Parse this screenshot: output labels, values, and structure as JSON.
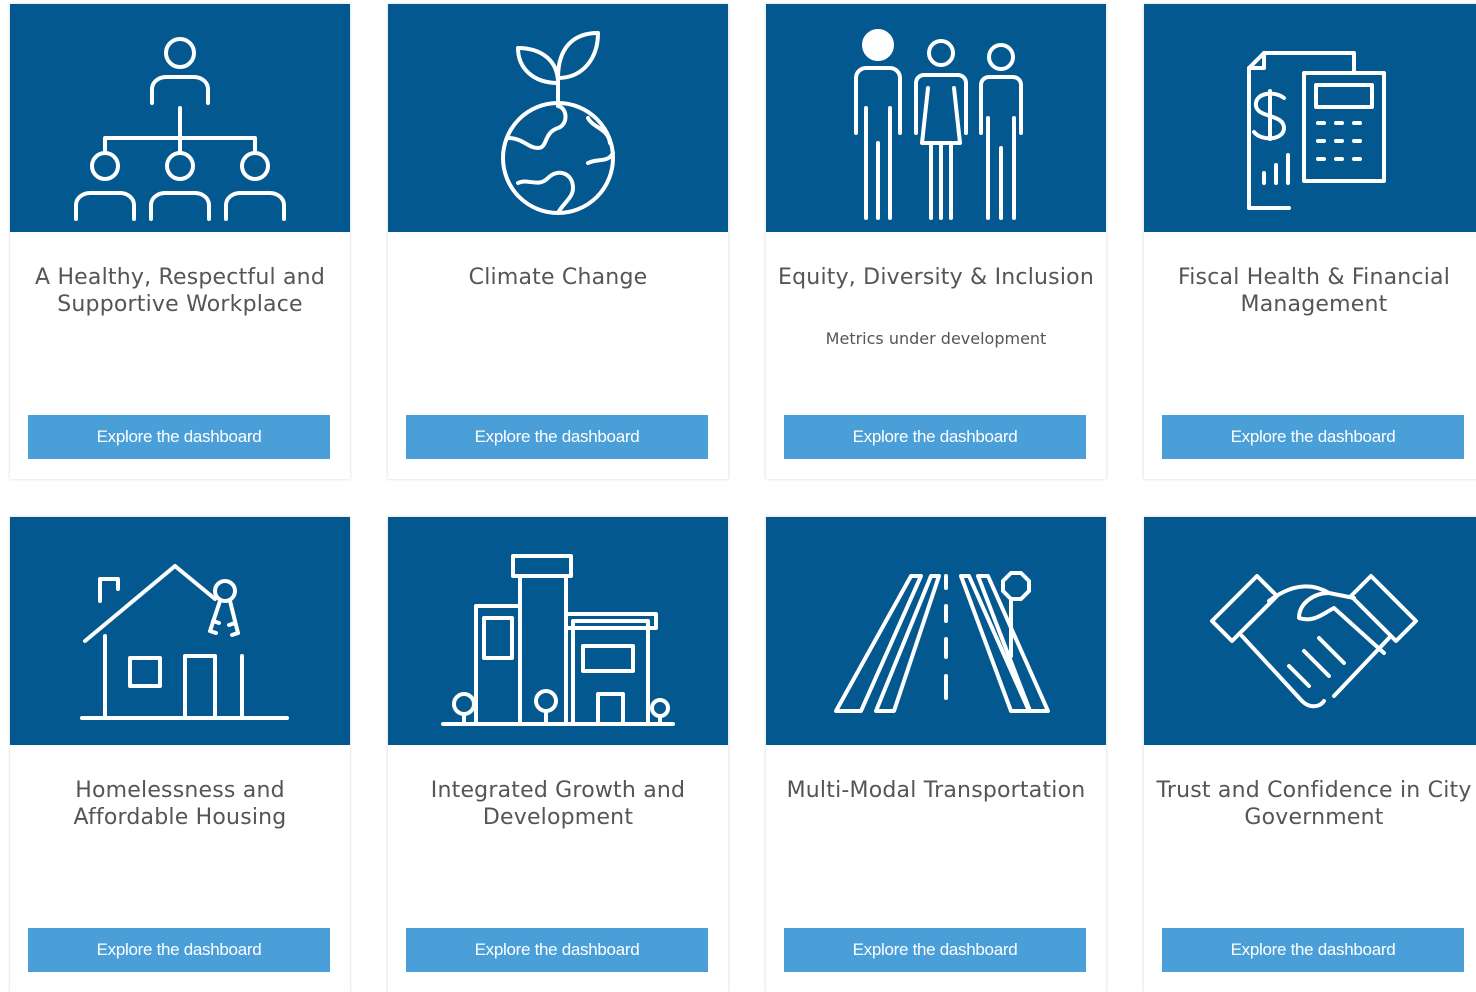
{
  "cards": [
    {
      "title": "A Healthy, Respectful and Supportive Workplace",
      "subtitle": "",
      "button": "Explore the dashboard",
      "icon": "org-chart-icon"
    },
    {
      "title": "Climate Change",
      "subtitle": "",
      "button": "Explore the dashboard",
      "icon": "plant-globe-icon"
    },
    {
      "title": "Equity, Diversity & Inclusion",
      "subtitle": "Metrics under development",
      "button": "Explore the dashboard",
      "icon": "people-group-icon"
    },
    {
      "title": "Fiscal Health & Financial Management",
      "subtitle": "",
      "button": "Explore the dashboard",
      "icon": "finance-calculator-icon"
    },
    {
      "title": "Homelessness and Affordable Housing",
      "subtitle": "",
      "button": "Explore the dashboard",
      "icon": "house-keys-icon"
    },
    {
      "title": "Integrated Growth and Development",
      "subtitle": "",
      "button": "Explore the dashboard",
      "icon": "city-buildings-icon"
    },
    {
      "title": "Multi-Modal Transportation",
      "subtitle": "",
      "button": "Explore the dashboard",
      "icon": "road-icon"
    },
    {
      "title": "Trust and Confidence in City Government",
      "subtitle": "",
      "button": "Explore the dashboard",
      "icon": "handshake-icon"
    }
  ],
  "colors": {
    "banner": "#03588f",
    "button": "#4a9fd8",
    "title_text": "#555555"
  }
}
